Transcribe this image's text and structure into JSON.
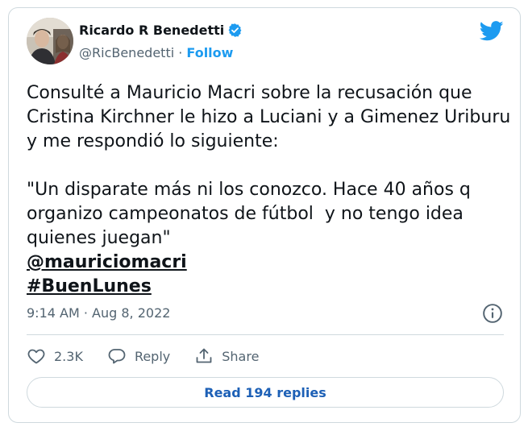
{
  "author": {
    "name": "Ricardo R Benedetti",
    "handle": "@RicBenedetti",
    "separator": " · ",
    "follow_label": "Follow"
  },
  "tweet": {
    "text": "Consulté a Mauricio Macri sobre la recusación que Cristina Kirchner le hizo a Luciani y a Gimenez Uriburu y me respondió lo siguiente:\n\n\"Un disparate más ni los conozco. Hace 40 años q organizo campeonatos de fútbol  y no tengo idea quienes juegan\"",
    "mention": "@mauriciomacri",
    "hashtag": "#BuenLunes"
  },
  "meta": {
    "time": "9:14 AM",
    "separator": " · ",
    "date": "Aug 8, 2022"
  },
  "actions": {
    "like_count": "2.3K",
    "reply_label": "Reply",
    "share_label": "Share"
  },
  "read_replies_label": "Read 194 replies",
  "colors": {
    "twitter_blue": "#1d9bf0",
    "link_blue": "#1d60b6",
    "secondary_text": "#536471",
    "border": "#cfd9de"
  },
  "icons": [
    "verified-badge-icon",
    "twitter-bird-icon",
    "info-icon",
    "heart-icon",
    "reply-icon",
    "share-icon"
  ]
}
